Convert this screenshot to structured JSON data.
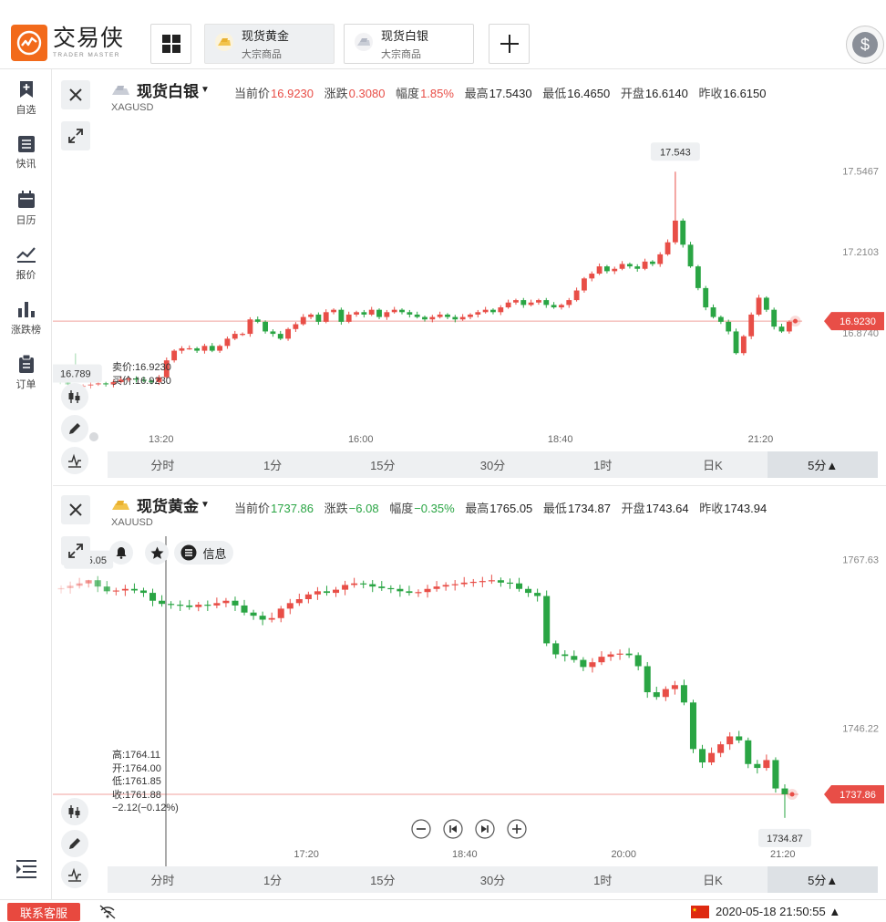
{
  "logo": {
    "cn": "交易侠",
    "en": "TRADER MASTER"
  },
  "tabs": [
    {
      "name": "现货黄金",
      "sub": "大宗商品",
      "active": true
    },
    {
      "name": "现货白银",
      "sub": "大宗商品",
      "active": false
    }
  ],
  "sidebar": [
    {
      "label": "自选",
      "icon": "bookmark-add-icon"
    },
    {
      "label": "快讯",
      "icon": "news-list-icon"
    },
    {
      "label": "日历",
      "icon": "calendar-icon"
    },
    {
      "label": "报价",
      "icon": "trend-line-icon"
    },
    {
      "label": "涨跌榜",
      "icon": "bar-ranking-icon"
    },
    {
      "label": "订单",
      "icon": "clipboard-icon"
    }
  ],
  "colors": {
    "up": "#e84e47",
    "down": "#2aa544",
    "accent": "#f26a1b",
    "pane": "#eef0f2"
  },
  "timeframes": [
    "分时",
    "1分",
    "15分",
    "30分",
    "1时",
    "日K",
    "5分▲"
  ],
  "active_timeframe": "5分▲",
  "silver": {
    "name": "现货白银",
    "code": "XAGUSD",
    "quote": [
      {
        "label": "当前价",
        "value": "16.9230",
        "tone": "red"
      },
      {
        "label": "涨跌",
        "value": "0.3080",
        "tone": "red"
      },
      {
        "label": "幅度",
        "value": "1.85%",
        "tone": "red"
      },
      {
        "label": "最高",
        "value": "17.5430",
        "tone": ""
      },
      {
        "label": "最低",
        "value": "16.4650",
        "tone": ""
      },
      {
        "label": "开盘",
        "value": "16.6140",
        "tone": ""
      },
      {
        "label": "昨收",
        "value": "16.6150",
        "tone": ""
      }
    ],
    "bid": "卖价:16.9230",
    "ask": "买价:16.9230",
    "y_ticks": [
      "17.5467",
      "17.2103",
      "16.8740"
    ],
    "x_ticks": [
      "13:20",
      "16:00",
      "18:40",
      "21:20"
    ],
    "max_label": "17.543",
    "min_label": "16.789",
    "price_tag": "16.9230"
  },
  "gold": {
    "name": "现货黄金",
    "code": "XAUUSD",
    "quote": [
      {
        "label": "当前价",
        "value": "1737.86",
        "tone": "green"
      },
      {
        "label": "涨跌",
        "value": "−6.08",
        "tone": "green"
      },
      {
        "label": "幅度",
        "value": "−0.35%",
        "tone": "green"
      },
      {
        "label": "最高",
        "value": "1765.05",
        "tone": ""
      },
      {
        "label": "最低",
        "value": "1734.87",
        "tone": ""
      },
      {
        "label": "开盘",
        "value": "1743.64",
        "tone": ""
      },
      {
        "label": "昨收",
        "value": "1743.94",
        "tone": ""
      }
    ],
    "info_label": "信息",
    "ohlc": [
      "高:1764.11",
      "开:1764.00",
      "低:1761.85",
      "收:1761.88",
      "−2.12(−0.12%)"
    ],
    "y_ticks": [
      "1767.63",
      "1746.22"
    ],
    "x_ticks": [
      "17:20",
      "18:40",
      "20:00",
      "21:20"
    ],
    "max_label": "1765.05",
    "min_label": "1734.87",
    "price_tag": "1737.86"
  },
  "footer": {
    "support": "联系客服",
    "datetime": "2020‑05‑18 21:50:55 ▲"
  },
  "chart_data": [
    {
      "type": "candlestick",
      "title": "现货白银 XAGUSD 5分",
      "x_ticks": [
        "13:20",
        "16:00",
        "18:40",
        "21:20"
      ],
      "y_ticks": [
        17.5467,
        17.2103,
        16.874
      ],
      "ylim": [
        16.7,
        17.65
      ],
      "high": 17.543,
      "low": 16.789,
      "last": 16.923,
      "close_series": [
        16.67,
        16.66,
        16.65,
        16.655,
        16.66,
        16.665,
        16.66,
        16.67,
        16.68,
        16.685,
        16.68,
        16.675,
        16.67,
        16.69,
        16.76,
        16.8,
        16.81,
        16.81,
        16.8,
        16.82,
        16.8,
        16.82,
        16.85,
        16.87,
        16.87,
        16.93,
        16.92,
        16.88,
        16.87,
        16.85,
        16.89,
        16.91,
        16.94,
        16.95,
        16.92,
        16.96,
        16.97,
        16.92,
        16.95,
        16.96,
        16.95,
        16.97,
        16.94,
        16.96,
        16.97,
        16.96,
        16.95,
        16.94,
        16.93,
        16.94,
        16.95,
        16.94,
        16.93,
        16.94,
        16.95,
        16.96,
        16.97,
        16.96,
        16.98,
        17.0,
        17.01,
        16.99,
        17.0,
        17.01,
        16.99,
        16.98,
        16.99,
        17.01,
        17.05,
        17.1,
        17.12,
        17.15,
        17.13,
        17.14,
        17.16,
        17.15,
        17.14,
        17.17,
        17.16,
        17.2,
        17.25,
        17.34,
        17.24,
        17.15,
        17.06,
        16.98,
        16.94,
        16.92,
        16.88,
        16.79,
        16.86,
        16.95,
        17.02,
        16.97,
        16.9,
        16.88,
        16.92
      ]
    },
    {
      "type": "candlestick",
      "title": "现货黄金 XAUUSD 5分",
      "x_ticks": [
        "17:20",
        "18:40",
        "20:00",
        "21:20"
      ],
      "y_ticks": [
        1767.63,
        1746.22
      ],
      "ylim": [
        1733,
        1770
      ],
      "high": 1765.05,
      "low": 1734.87,
      "last": 1737.86,
      "close_series": [
        1764.0,
        1764.3,
        1764.6,
        1765.0,
        1764.2,
        1763.6,
        1763.7,
        1763.9,
        1763.7,
        1763.4,
        1762.4,
        1762.0,
        1761.9,
        1761.8,
        1761.6,
        1761.9,
        1761.8,
        1762.1,
        1762.4,
        1761.8,
        1760.9,
        1760.5,
        1760.0,
        1760.2,
        1761.4,
        1762.1,
        1762.6,
        1763.2,
        1763.6,
        1763.4,
        1763.8,
        1764.4,
        1764.6,
        1764.5,
        1764.2,
        1764.0,
        1763.9,
        1763.6,
        1763.4,
        1763.5,
        1763.9,
        1764.2,
        1764.4,
        1764.5,
        1764.7,
        1764.8,
        1764.9,
        1765.0,
        1764.7,
        1764.6,
        1763.9,
        1763.4,
        1763.0,
        1757.0,
        1755.6,
        1755.4,
        1754.9,
        1754.0,
        1754.6,
        1755.3,
        1755.6,
        1755.7,
        1755.5,
        1754.1,
        1750.8,
        1750.2,
        1751.2,
        1751.7,
        1749.5,
        1743.6,
        1741.9,
        1743.1,
        1744.2,
        1745.2,
        1744.7,
        1741.7,
        1741.2,
        1742.2,
        1738.6,
        1737.86
      ]
    }
  ]
}
